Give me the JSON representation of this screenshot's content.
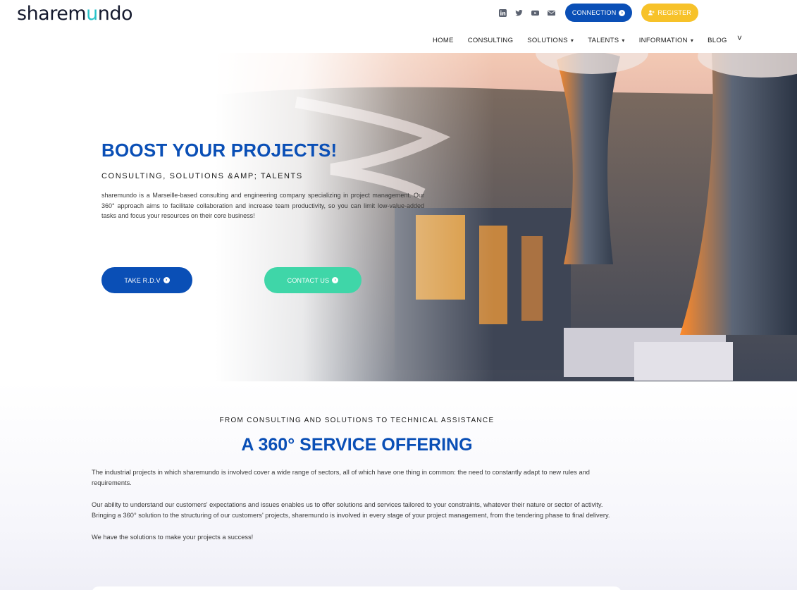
{
  "header": {
    "logo": {
      "prefix": "sharem",
      "accent": "u",
      "suffix": "ndo"
    },
    "social_icons": [
      "linkedin-icon",
      "twitter-icon",
      "youtube-icon",
      "email-icon"
    ],
    "connection_label": "CONNECTION",
    "register_label": "REGISTER",
    "menu": [
      {
        "label": "HOME",
        "dropdown": false
      },
      {
        "label": "CONSULTING",
        "dropdown": false
      },
      {
        "label": "SOLUTIONS",
        "dropdown": true
      },
      {
        "label": "TALENTS",
        "dropdown": true
      },
      {
        "label": "INFORMATION",
        "dropdown": true
      },
      {
        "label": "BLOG",
        "dropdown": false
      }
    ]
  },
  "hero": {
    "title": "BOOST YOUR PROJECTS!",
    "subtitle": "CONSULTING, SOLUTIONS &AMP; TALENTS",
    "text": "sharemundo is a Marseille-based consulting and engineering company specializing in project management. Our 360° approach aims to facilitate collaboration and increase team productivity, so you can limit low-value-added tasks and focus your resources on their core business!",
    "cta_rdv": "TAKE R.D.V",
    "cta_contact": "CONTACT US"
  },
  "services": {
    "eyebrow": "FROM CONSULTING AND SOLUTIONS TO TECHNICAL ASSISTANCE",
    "title": "A 360° SERVICE OFFERING",
    "paragraphs": [
      "The industrial projects in which sharemundo is involved cover a wide range of sectors, all of which have one thing in common: the need to constantly adapt to new rules and requirements.",
      "Our ability to understand our customers' expectations and issues enables us to offer solutions and services tailored to your constraints, whatever their nature or sector of activity. Bringing a 360° solution to the structuring of our customers' projects, sharemundo is involved in every stage of your project management, from the tendering phase to final delivery.",
      "We have the solutions to make your projects a success!"
    ]
  },
  "colors": {
    "brand_blue": "#0a4fb6",
    "brand_teal": "#27c2c9",
    "cta_green": "#3fd6a8",
    "register_yellow": "#f7c229"
  }
}
